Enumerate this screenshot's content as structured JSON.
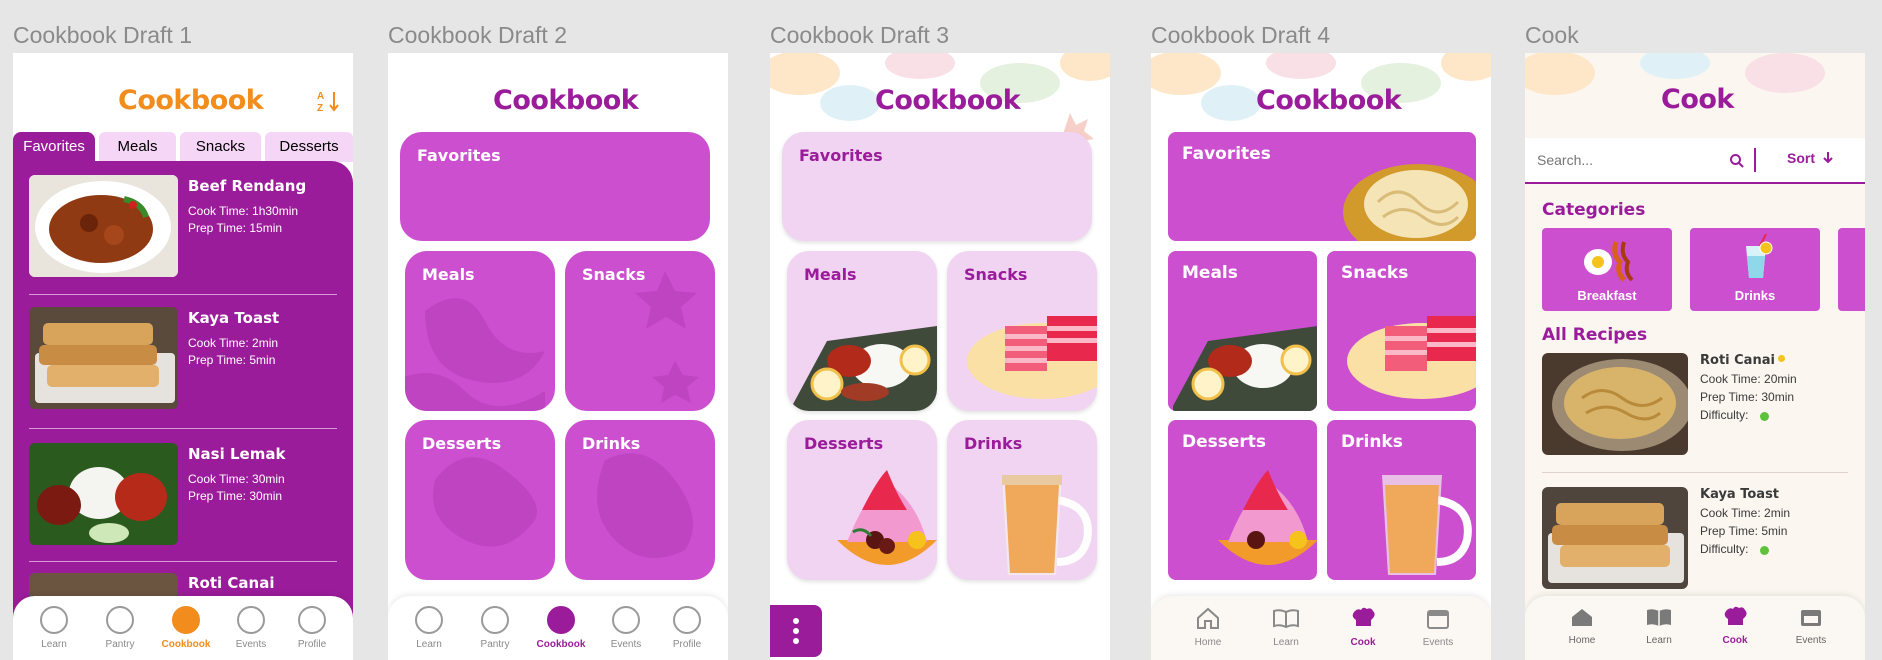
{
  "frames": [
    {
      "title": "Cookbook Draft 1"
    },
    {
      "title": "Cookbook Draft 2"
    },
    {
      "title": "Cookbook Draft 3"
    },
    {
      "title": "Cookbook Draft 4"
    },
    {
      "title": "Cook"
    }
  ],
  "d1": {
    "logo": "Cookbook",
    "sort_icon": "A Z",
    "tabs": [
      "Favorites",
      "Meals",
      "Snacks",
      "Desserts"
    ],
    "recipes": [
      {
        "name": "Beef Rendang",
        "cook": "Cook Time: 1h30min",
        "prep": "Prep Time: 15min"
      },
      {
        "name": "Kaya Toast",
        "cook": "Cook Time: 2min",
        "prep": "Prep Time: 5min"
      },
      {
        "name": "Nasi Lemak",
        "cook": "Cook Time: 30min",
        "prep": "Prep Time: 30min"
      },
      {
        "name": "Roti Canai"
      }
    ],
    "nav": [
      "Learn",
      "Pantry",
      "Cookbook",
      "Events",
      "Profile"
    ]
  },
  "d2": {
    "logo": "Cookbook",
    "tiles": [
      "Favorites",
      "Meals",
      "Snacks",
      "Desserts",
      "Drinks"
    ],
    "nav": [
      "Learn",
      "Pantry",
      "Cookbook",
      "Events",
      "Profile"
    ]
  },
  "d3": {
    "logo": "Cookbook",
    "tiles": [
      "Favorites",
      "Meals",
      "Snacks",
      "Desserts",
      "Drinks"
    ]
  },
  "d4": {
    "logo": "Cookbook",
    "tiles": [
      "Favorites",
      "Meals",
      "Snacks",
      "Desserts",
      "Drinks"
    ],
    "nav": [
      "Home",
      "Learn",
      "Cook",
      "Events"
    ]
  },
  "d5": {
    "logo": "Cook",
    "search_placeholder": "Search...",
    "sort_label": "Sort",
    "categories_heading": "Categories",
    "categories": [
      "Breakfast",
      "Drinks"
    ],
    "all_recipes_heading": "All Recipes",
    "recipes": [
      {
        "name": "Roti Canai",
        "cook": "Cook Time: 20min",
        "prep": "Prep Time: 30min",
        "difficulty": "Difficulty:"
      },
      {
        "name": "Kaya Toast",
        "cook": "Cook Time: 2min",
        "prep": "Prep Time: 5min",
        "difficulty": "Difficulty:"
      }
    ],
    "nav": [
      "Home",
      "Learn",
      "Cook",
      "Events"
    ]
  },
  "colors": {
    "orange": "#f28c1c",
    "purple": "#9b1c9b",
    "magenta": "#cc4fcf",
    "lilac": "#f1d4f1",
    "green": "#5dc23a"
  }
}
